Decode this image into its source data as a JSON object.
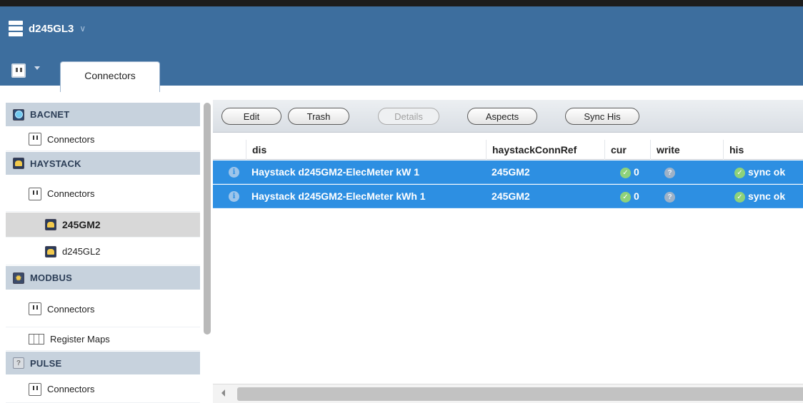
{
  "header": {
    "project_name": "d245GL3",
    "active_tab": "Connectors"
  },
  "sidebar": {
    "sections": [
      {
        "label": "BACNET",
        "icon": "bacnet-icon",
        "items": [
          {
            "label": "Connectors",
            "icon": "plug-icon"
          }
        ]
      },
      {
        "label": "HAYSTACK",
        "icon": "haystack-icon",
        "items": [
          {
            "label": "Connectors",
            "icon": "plug-icon"
          },
          {
            "label": "245GM2",
            "icon": "haystack-icon",
            "selected": true
          },
          {
            "label": "d245GL2",
            "icon": "haystack-icon"
          }
        ]
      },
      {
        "label": "MODBUS",
        "icon": "modbus-icon",
        "items": [
          {
            "label": "Connectors",
            "icon": "plug-icon"
          },
          {
            "label": "Register Maps",
            "icon": "grid-icon"
          }
        ]
      },
      {
        "label": "PULSE",
        "icon": "pulse-icon",
        "items": [
          {
            "label": "Connectors",
            "icon": "plug-icon"
          }
        ]
      }
    ]
  },
  "toolbar": {
    "buttons": [
      {
        "label": "Edit",
        "enabled": true
      },
      {
        "label": "Trash",
        "enabled": true
      },
      {
        "label": "Details",
        "enabled": false
      },
      {
        "label": "Aspects",
        "enabled": true
      },
      {
        "label": "Sync His",
        "enabled": true
      }
    ]
  },
  "grid": {
    "columns": [
      "dis",
      "haystackConnRef",
      "cur",
      "write",
      "his"
    ],
    "rows": [
      {
        "dis": "Haystack d245GM2-ElecMeter kW 1",
        "haystackConnRef": "245GM2",
        "cur": "0",
        "write": "?",
        "his": "sync ok"
      },
      {
        "dis": "Haystack d245GM2-ElecMeter kWh 1",
        "haystackConnRef": "245GM2",
        "cur": "0",
        "write": "?",
        "his": "sync ok"
      }
    ],
    "selected_row_color": "#2d8fe2"
  },
  "colors": {
    "header_bg": "#3d6e9e",
    "sidebar_header_bg": "#c7d2dd",
    "ok_green": "#8ed27a"
  }
}
